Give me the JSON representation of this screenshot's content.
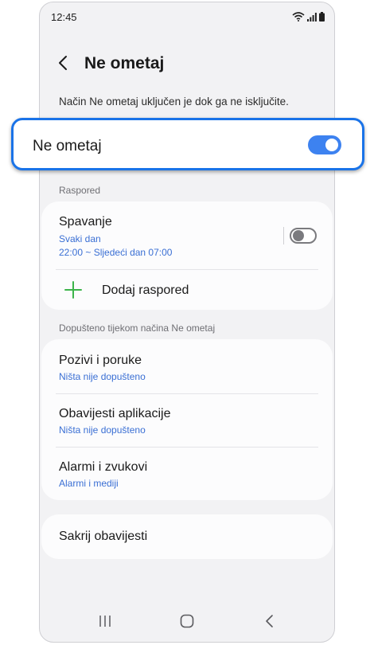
{
  "status_bar": {
    "time": "12:45",
    "icons": [
      "wifi-icon",
      "signal-icon",
      "battery-icon"
    ]
  },
  "header": {
    "back_icon": "chevron-left-icon",
    "title": "Ne ometaj"
  },
  "description": "Način Ne ometaj uključen je dok ga ne isključite.",
  "main_toggle": {
    "label": "Ne ometaj",
    "on": true,
    "color": "#3d82f0",
    "highlight_color": "#1a73e8"
  },
  "schedule_section": {
    "label": "Raspored",
    "items": [
      {
        "title": "Spavanje",
        "subtitle1": "Svaki dan",
        "subtitle2": "22:00 ~ Sljedeći dan 07:00",
        "toggle_on": false
      }
    ],
    "add_label": "Dodaj raspored",
    "add_icon": "plus-icon",
    "add_icon_color": "#3cb44a"
  },
  "allowed_section": {
    "label": "Dopušteno tijekom načina Ne ometaj",
    "items": [
      {
        "title": "Pozivi i poruke",
        "subtitle": "Ništa nije dopušteno"
      },
      {
        "title": "Obavijesti aplikacije",
        "subtitle": "Ništa nije dopušteno"
      },
      {
        "title": "Alarmi i zvukovi",
        "subtitle": "Alarmi i mediji"
      }
    ]
  },
  "hide_notifications": {
    "label": "Sakrij obavijesti"
  },
  "nav_bar": {
    "icons": [
      "recents-icon",
      "home-icon",
      "back-icon"
    ]
  },
  "accent_color": "#3a6fd4"
}
